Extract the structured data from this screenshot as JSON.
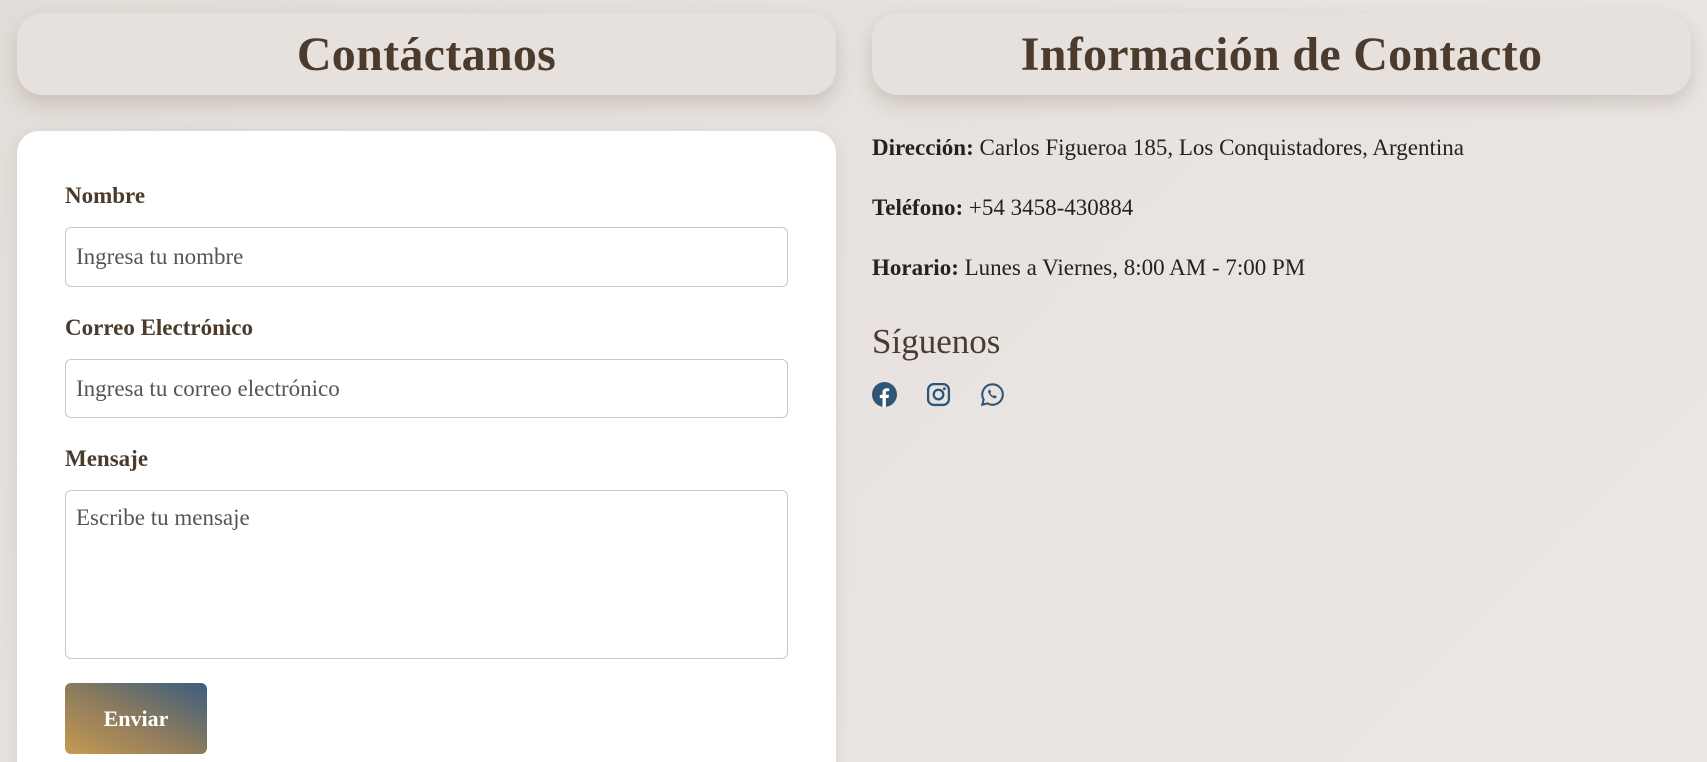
{
  "contact_form": {
    "title": "Contáctanos",
    "name_label": "Nombre",
    "name_placeholder": "Ingresa tu nombre",
    "email_label": "Correo Electrónico",
    "email_placeholder": "Ingresa tu correo electrónico",
    "message_label": "Mensaje",
    "message_placeholder": "Escribe tu mensaje",
    "submit_label": "Enviar"
  },
  "contact_info": {
    "title": "Información de Contacto",
    "address_label": "Dirección:",
    "address_value": "Carlos Figueroa 185, Los Conquistadores, Argentina",
    "phone_label": "Teléfono:",
    "phone_value": "+54 3458-430884",
    "hours_label": "Horario:",
    "hours_value": "Lunes a Viernes, 8:00 AM - 7:00 PM"
  },
  "social": {
    "title": "Síguenos",
    "icons": [
      "facebook-icon",
      "instagram-icon",
      "whatsapp-icon"
    ],
    "icon_color": "#2f5577"
  },
  "colors": {
    "heading_brown": "#4a3b2c",
    "button_gradient_start": "#c89a52",
    "button_gradient_end": "#3b5e80"
  }
}
